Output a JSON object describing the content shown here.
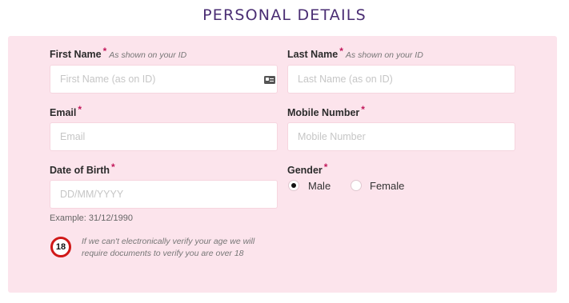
{
  "header": {
    "title": "PERSONAL DETAILS"
  },
  "form": {
    "first_name": {
      "label": "First Name",
      "required": "*",
      "hint": "As shown on your ID",
      "placeholder": "First Name (as on ID)",
      "icon": "id-card-icon"
    },
    "last_name": {
      "label": "Last Name",
      "required": "*",
      "hint": "As shown on your ID",
      "placeholder": "Last Name (as on ID)"
    },
    "email": {
      "label": "Email",
      "required": "*",
      "placeholder": "Email"
    },
    "mobile": {
      "label": "Mobile Number",
      "required": "*",
      "placeholder": "Mobile Number"
    },
    "dob": {
      "label": "Date of Birth",
      "required": "*",
      "placeholder": "DD/MM/YYYY",
      "example": "Example: 31/12/1990"
    },
    "gender": {
      "label": "Gender",
      "required": "*",
      "options": [
        "Male",
        "Female"
      ],
      "selected": "Male"
    },
    "age_notice": {
      "badge": "18",
      "text": "If we can't electronically verify your age we will require documents to verify you are over 18"
    }
  },
  "colors": {
    "title": "#4a2d73",
    "panel_bg": "#fce4ec",
    "required": "#c2185b",
    "age_badge_ring": "#d01818"
  }
}
